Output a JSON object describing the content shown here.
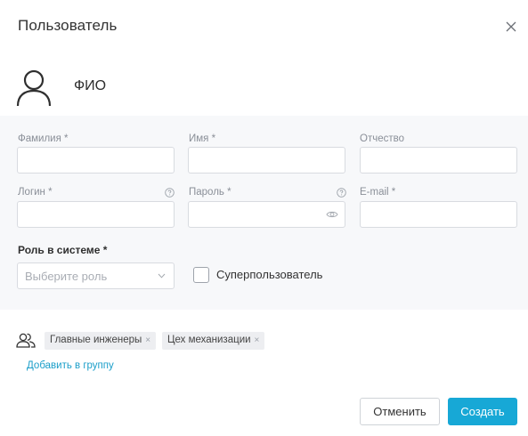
{
  "dialog": {
    "title": "Пользователь",
    "close_icon": "close-icon"
  },
  "profile": {
    "avatar_icon": "user-icon",
    "name_label": "ФИО"
  },
  "form": {
    "last_name": {
      "label": "Фамилия",
      "required": "*",
      "value": ""
    },
    "first_name": {
      "label": "Имя",
      "required": "*",
      "value": ""
    },
    "patronymic": {
      "label": "Отчество",
      "value": ""
    },
    "login": {
      "label": "Логин",
      "required": "*",
      "value": "",
      "help_icon": "help-icon"
    },
    "password": {
      "label": "Пароль",
      "required": "*",
      "value": "",
      "help_icon": "help-icon",
      "eye_icon": "eye-icon"
    },
    "email": {
      "label": "E-mail",
      "required": "*",
      "value": ""
    },
    "role": {
      "label": "Роль в системе",
      "required": "*",
      "placeholder": "Выберите роль"
    },
    "superuser": {
      "label": "Суперпользователь",
      "checked": false
    }
  },
  "groups": {
    "icon": "users-icon",
    "chips": [
      {
        "label": "Главные инженеры",
        "remove": "×"
      },
      {
        "label": "Цех механизации",
        "remove": "×"
      }
    ],
    "add_link": "Добавить в группу"
  },
  "footer": {
    "cancel_label": "Отменить",
    "create_label": "Создать"
  },
  "colors": {
    "accent": "#17a8d6",
    "link": "#1a9ec9",
    "panel_bg": "#f7f8fa"
  }
}
